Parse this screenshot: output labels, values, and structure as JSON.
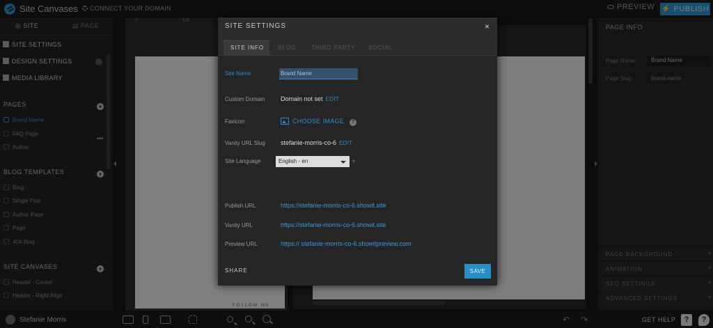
{
  "topbar": {
    "app_title": "Site Canvases",
    "connect_domain": "CONNECT YOUR DOMAIN",
    "preview": "PREVIEW",
    "publish": "PUBLISH"
  },
  "left_sidebar": {
    "tabs": [
      "SITE",
      "PAGE"
    ],
    "menu": [
      "SITE SETTINGS",
      "DESIGN SETTINGS",
      "MEDIA LIBRARY"
    ],
    "pages_heading": "PAGES",
    "pages": [
      "Brand Name",
      "FAQ Page",
      "Author"
    ],
    "blog_templates_heading": "BLOG TEMPLATES",
    "blog_templates": [
      "Blog",
      "Single Post",
      "Author Page",
      "Page",
      "404 Blog"
    ],
    "site_canvases_heading": "SITE CANVASES",
    "site_canvases": [
      "Header - Center",
      "Header - Right Align"
    ]
  },
  "canvas": {
    "ruler_marks": [
      "0",
      "100"
    ],
    "follow_text": "FOLLOW ME"
  },
  "right_panel": {
    "heading": "PAGE INFO",
    "page_name_label": "Page Name",
    "page_name_value": "Brand Name",
    "page_slug_label": "Page Slug",
    "page_slug_value": "brand-name",
    "sections": [
      "PAGE BACKGROUND",
      "ANIMATION",
      "SEO SETTINGS",
      "ADVANCED SETTINGS"
    ]
  },
  "bottombar": {
    "user": "Stefanie Morris",
    "get_help": "GET HELP",
    "help_q": "?"
  },
  "modal": {
    "title": "SITE SETTINGS",
    "close": "×",
    "tabs": [
      "SITE INFO",
      "BLOG",
      "THIRD PARTY",
      "SOCIAL"
    ],
    "site_name_label": "Site Name",
    "site_name_value": "Brand Name",
    "custom_domain_label": "Custom Domain",
    "custom_domain_value": "Domain not set",
    "edit": "EDIT",
    "favicon_label": "Favicon",
    "choose_image": "CHOOSE IMAGE",
    "help": "?",
    "vanity_slug_label": "Vanity URL Slug",
    "vanity_slug_value": "stefanie-morris-co-6",
    "site_language_label": "Site Language",
    "site_language_value": "English - en",
    "publish_url_label": "Publish URL",
    "publish_url": "https://stefanie-morris-co-6.showit.site",
    "vanity_url_label": "Vanity URL",
    "vanity_url": "https://stefanie-morris-co-6.showit.site",
    "preview_url_label": "Preview URL",
    "preview_url": "https:// stefanie-morris-co-6.showitpreview.com",
    "share": "SHARE",
    "save": "SAVE"
  },
  "colors": {
    "accent": "#2a8fc8",
    "background": "#1e1e1e",
    "modal": "#252525"
  }
}
